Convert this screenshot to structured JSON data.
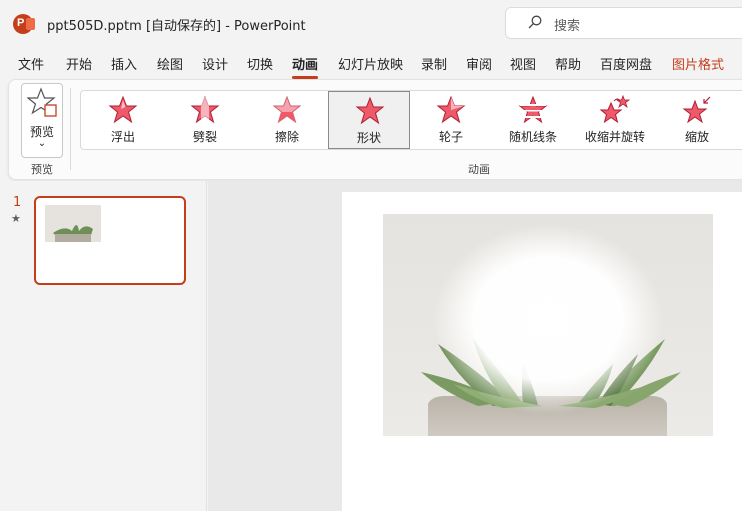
{
  "app": {
    "logo_letter": "P",
    "window_title": "ppt505D.pptm [自动保存的]  -  PowerPoint"
  },
  "search": {
    "placeholder": "搜索"
  },
  "menu": {
    "tabs": [
      "文件",
      "开始",
      "插入",
      "绘图",
      "设计",
      "切换",
      "动画",
      "幻灯片放映",
      "录制",
      "审阅",
      "视图",
      "帮助",
      "百度网盘",
      "图片格式"
    ],
    "active": "动画"
  },
  "ribbon": {
    "preview_button": "预览",
    "preview_group": "预览",
    "animation_group": "动画",
    "animations": [
      "浮出",
      "劈裂",
      "擦除",
      "形状",
      "轮子",
      "随机线条",
      "收缩并旋转",
      "缩放"
    ],
    "selected_animation": "形状"
  },
  "slides": {
    "items": [
      {
        "number": "1",
        "has_animation_marker": "★"
      }
    ]
  },
  "colors": {
    "accent": "#c43e1c",
    "star_fill": "#e84a5f",
    "star_stroke": "#c8102e"
  }
}
